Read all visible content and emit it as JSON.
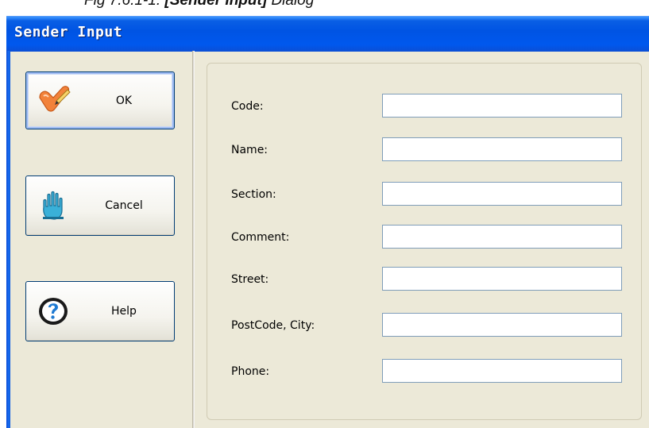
{
  "caption": {
    "prefix": "Fig 7.6.1-1: ",
    "bold": "[Sender Input]",
    "suffix": " Dialog"
  },
  "window": {
    "title": "Sender Input"
  },
  "buttons": {
    "ok": {
      "label": "OK",
      "icon": "checkmark-pen-icon"
    },
    "cancel": {
      "label": "Cancel",
      "icon": "hand-stop-icon"
    },
    "help": {
      "label": "Help",
      "icon": "help-question-icon"
    }
  },
  "fields": [
    {
      "id": "code",
      "label": "Code:",
      "value": ""
    },
    {
      "id": "name",
      "label": "Name:",
      "value": ""
    },
    {
      "id": "section",
      "label": "Section:",
      "value": ""
    },
    {
      "id": "comment",
      "label": "Comment:",
      "value": ""
    },
    {
      "id": "street",
      "label": "Street:",
      "value": ""
    },
    {
      "id": "postcode-city",
      "label": "PostCode, City:",
      "value": ""
    },
    {
      "id": "phone",
      "label": "Phone:",
      "value": ""
    }
  ],
  "colors": {
    "titlebar": "#0054e3",
    "dialog_bg": "#ece9d8",
    "button_border": "#003c74",
    "input_border": "#7f9db9"
  }
}
